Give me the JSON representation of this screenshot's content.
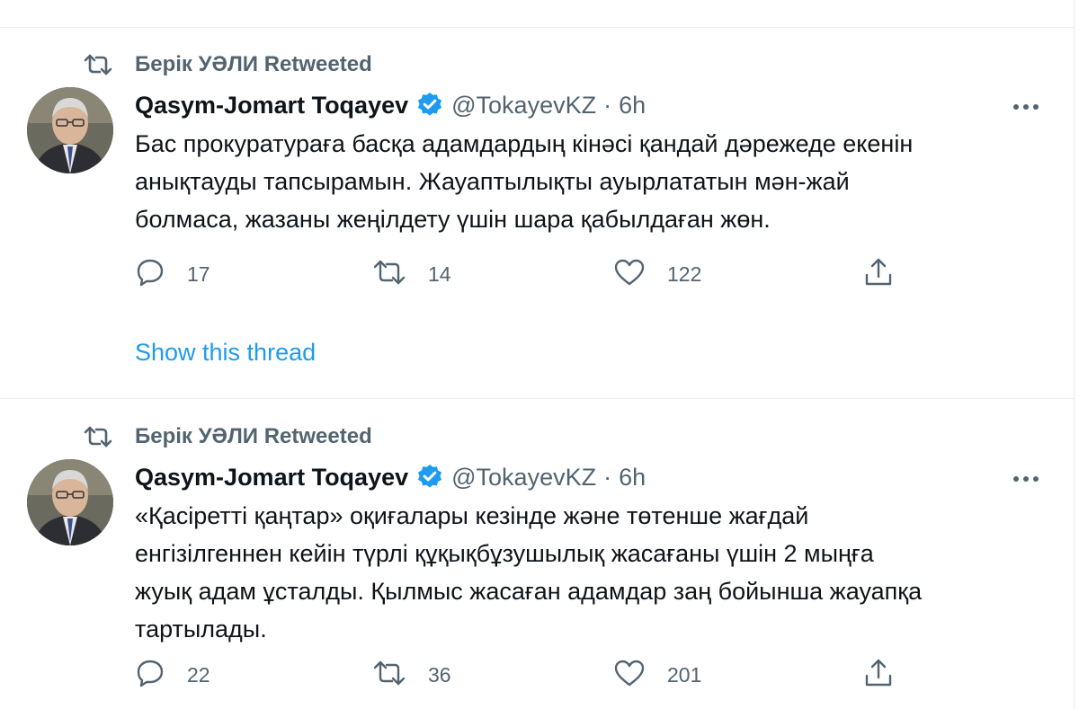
{
  "tweets": [
    {
      "retweeted_by": "Берік УӘЛИ Retweeted",
      "author_name": "Qasym-Jomart Toqayev",
      "handle": "@TokayevKZ",
      "separator": "·",
      "time": "6h",
      "text_lines": [
        "Бас прокуратураға басқа адамдардың кінәсі қандай дәрежеде екенін",
        "анықтауды тапсырамын. Жауаптылықты ауырлататын мән-жай",
        "болмаса, жазаны жеңілдету үшін шара қабылдаған жөн."
      ],
      "replies": "17",
      "retweets": "14",
      "likes": "122",
      "show_thread": "Show this thread"
    },
    {
      "retweeted_by": "Берік УӘЛИ Retweeted",
      "author_name": "Qasym-Jomart Toqayev",
      "handle": "@TokayevKZ",
      "separator": "·",
      "time": "6h",
      "text_lines": [
        "«Қасіретті қаңтар» оқиғалары кезінде және төтенше жағдай",
        "енгізілгеннен кейін түрлі құқықбұзушылық жасағаны үшін 2 мыңға",
        "жуық адам ұсталды. Қылмыс жасаған адамдар заң бойынша жауапқа",
        "тартылады."
      ],
      "replies": "22",
      "retweets": "36",
      "likes": "201"
    }
  ],
  "colors": {
    "text": "#0f1419",
    "secondary": "#536471",
    "link": "#1d9bf0",
    "verified": "#1d9bf0",
    "divider": "#e6ecf0"
  },
  "icons": [
    "retweet-icon",
    "verified-badge-icon",
    "more-icon",
    "reply-icon",
    "like-icon",
    "share-icon"
  ]
}
